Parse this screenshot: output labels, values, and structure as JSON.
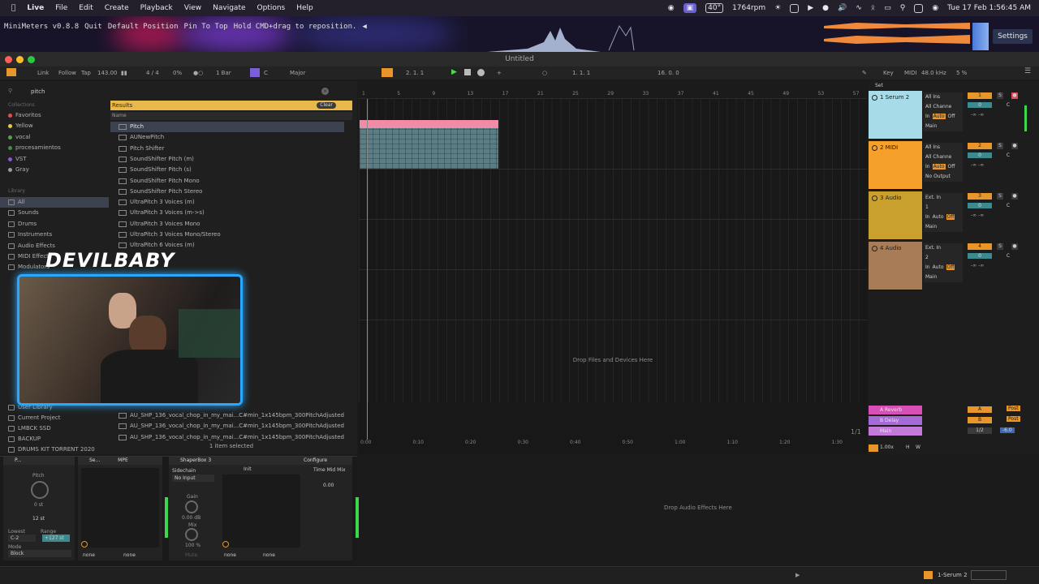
{
  "menubar": {
    "app_name": "Live",
    "items": [
      "File",
      "Edit",
      "Create",
      "Playback",
      "View",
      "Navigate",
      "Options",
      "Help"
    ],
    "temp": "40°",
    "rpm": "1764rpm",
    "datetime": "Tue 17 Feb  1:56:45 AM"
  },
  "minimeters": {
    "version": "MiniMeters v0.8.8",
    "quit": "Quit",
    "default_position": "Default Position",
    "pin": "Pin To Top",
    "hint": "Hold CMD+drag to reposition.",
    "arrow": "◀",
    "settings": "Settings"
  },
  "window": {
    "title": "Untitled"
  },
  "control_bar": {
    "link": "Link",
    "follow": "Follow",
    "tap": "Tap",
    "tempo": "143.00",
    "signature": "4 / 4",
    "percent": "0%",
    "quantize": "1 Bar",
    "key": "C",
    "scale": "Major",
    "position": "2.   1.   1",
    "loop_start": "1.   1.   1",
    "loop_len": "16.   0.   0",
    "key_label": "Key",
    "midi_label": "MIDI",
    "sample_rate": "48.0 kHz",
    "cpu": "5 %"
  },
  "browser": {
    "search_value": "pitch",
    "collections_label": "Collections",
    "collections": [
      {
        "label": "Favoritos",
        "color": "#e05050"
      },
      {
        "label": "Yellow",
        "color": "#e8c84a"
      },
      {
        "label": "vocal",
        "color": "#5aa04a"
      },
      {
        "label": "procesamientos",
        "color": "#4a8a4a"
      },
      {
        "label": "VST",
        "color": "#8a5ad0"
      },
      {
        "label": "Gray",
        "color": "#9a9a9a"
      }
    ],
    "library_label": "Library",
    "library": [
      "All",
      "Sounds",
      "Drums",
      "Instruments",
      "Audio Effects",
      "MIDI Effects",
      "Modulators"
    ],
    "places": [
      "User Library",
      "Current Project",
      "LMBCK SSD",
      "BACKUP",
      "DRUMS KIT TORRENT 2020"
    ],
    "results_label": "Results",
    "clear_label": "Clear",
    "name_header": "Name",
    "results": [
      "Pitch",
      "AUNewPitch",
      "Pitch Shifter",
      "SoundShifter Pitch (m)",
      "SoundShifter Pitch (s)",
      "SoundShifter Pitch Mono",
      "SoundShifter Pitch Stereo",
      "UltraPitch 3 Voices (m)",
      "UltraPitch 3 Voices (m->s)",
      "UltraPitch 3 Voices Mono",
      "UltraPitch 3 Voices Mono/Stereo",
      "UltraPitch 6 Voices (m)"
    ],
    "bottom_results": [
      "AU_SHP_136_vocal_chop_in_my_mai...C#min_1x145bpm_300PitchAdjusted",
      "AU_SHP_136_vocal_chop_in_my_mai...C#min_1x145bpm_300PitchAdjusted",
      "AU_SHP_136_vocal_chop_in_my_mai...C#min_1x145bpm_300PitchAdjusted"
    ],
    "selection_status": "1 item selected"
  },
  "arrangement": {
    "bar_numbers": [
      "1",
      "5",
      "9",
      "13",
      "17",
      "21",
      "25",
      "29",
      "33",
      "37",
      "41",
      "45",
      "49",
      "53",
      "57"
    ],
    "drop_text": "Drop Files and Devices Here",
    "time_labels": [
      "0:00",
      "0:10",
      "0:20",
      "0:30",
      "0:40",
      "0:50",
      "1:00",
      "1:10",
      "1:20",
      "1:30"
    ],
    "page": "1/1",
    "set_label": "Set"
  },
  "mixer": {
    "tracks": [
      {
        "name": "1 Serum 2",
        "color": "#a8dbe8",
        "input": "All Ins",
        "channel": "All Channe",
        "monitor": [
          "In",
          "Auto",
          "Off"
        ],
        "output": "Main",
        "number": "1"
      },
      {
        "name": "2 MIDI",
        "color": "#f5a02a",
        "input": "All Ins",
        "channel": "All Channe",
        "monitor": [
          "In",
          "Auto",
          "Off"
        ],
        "output": "No Output",
        "number": "2"
      },
      {
        "name": "3 Audio",
        "color": "#c9a02e",
        "input": "Ext. In",
        "channel": "1",
        "monitor": [
          "In",
          "Auto",
          "Off"
        ],
        "output": "Main",
        "number": "3"
      },
      {
        "name": "4 Audio",
        "color": "#a97c58",
        "input": "Ext. In",
        "channel": "2",
        "monitor": [
          "In",
          "Auto",
          "Off"
        ],
        "output": "Main",
        "number": "4"
      }
    ],
    "pan_label": "C",
    "returns": [
      {
        "name": "A Reverb",
        "color": "#d94fb8",
        "letter": "A",
        "post": "Post"
      },
      {
        "name": "B Delay",
        "color": "#a86ad8",
        "letter": "B",
        "post": "Post"
      },
      {
        "name": "Main",
        "color": "#c47ad8",
        "letter": "1/2"
      }
    ],
    "main_db": "-6.0",
    "zoom": "1.00x",
    "hw": [
      "H",
      "W"
    ]
  },
  "devices": {
    "pitch": {
      "title": "P...",
      "knob_label": "Pitch",
      "value": "0 st",
      "range_value": "12 st",
      "lowest_label": "Lowest",
      "lowest": "C-2",
      "range_label": "Range",
      "range": "+127 st",
      "mode_label": "Mode",
      "mode": "Block"
    },
    "serum": {
      "title": "Se...",
      "mpe": "MPE",
      "none1": "none",
      "none2": "none"
    },
    "shaperbox": {
      "title": "ShaperBox 3",
      "configure": "Configure",
      "sidechain": "Sidechain",
      "sc_value": "No Input",
      "gain_label": "Gain",
      "gain_value": "0.00 dB",
      "mix_label": "Mix",
      "mix_value": "100 %",
      "mute": "Mute",
      "preset": "Init",
      "timemidmix": "Time Mid Mix",
      "tmm_value": "0.00",
      "none1": "none",
      "none2": "none"
    },
    "drop_fx": "Drop Audio Effects Here"
  },
  "status_bar": {
    "track": "1-Serum 2"
  },
  "overlay": {
    "streamer": "DEVILBABY"
  }
}
